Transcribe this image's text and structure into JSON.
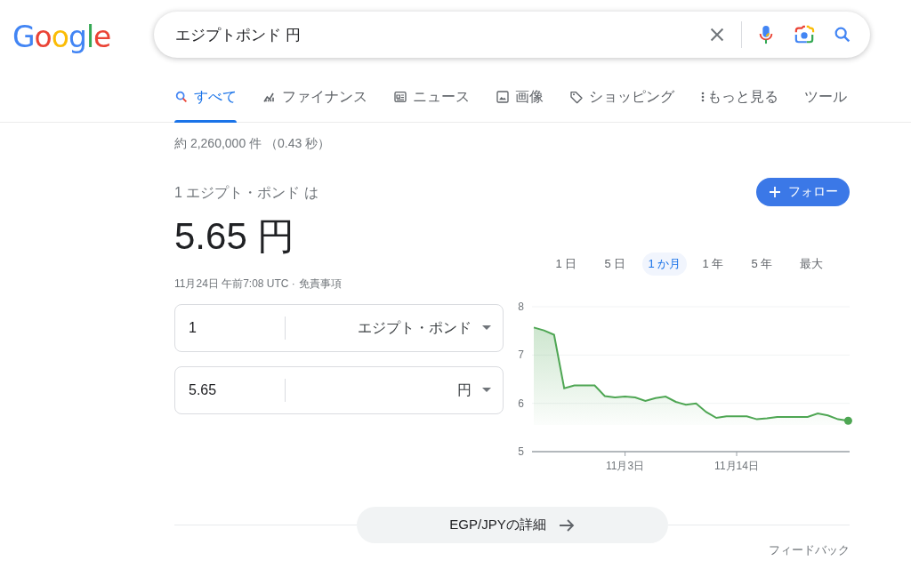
{
  "logo": "Google",
  "search": {
    "value": "エジプトポンド 円"
  },
  "tabs": [
    {
      "label": "すべて",
      "selected": true,
      "kind": "search"
    },
    {
      "label": "ファイナンス",
      "selected": false,
      "kind": "finance"
    },
    {
      "label": "ニュース",
      "selected": false,
      "kind": "news"
    },
    {
      "label": "画像",
      "selected": false,
      "kind": "images"
    },
    {
      "label": "ショッピング",
      "selected": false,
      "kind": "shopping"
    },
    {
      "label": "もっと見る",
      "selected": false,
      "kind": "more"
    },
    {
      "label": "ツール",
      "selected": false,
      "kind": "tools"
    }
  ],
  "result_stats": "約 2,260,000 件 （0.43 秒）",
  "converter": {
    "heading": "1 エジプト・ポンド は",
    "result": "5.65 円",
    "timestamp": "11月24日 午前7:08 UTC ·",
    "disclaimer_link": "免責事項",
    "follow_button": "フォロー",
    "rows": [
      {
        "amount": "1",
        "currency": "エジプト・ポンド"
      },
      {
        "amount": "5.65",
        "currency": "円"
      }
    ],
    "ranges": [
      {
        "label": "1 日",
        "selected": false
      },
      {
        "label": "5 日",
        "selected": false
      },
      {
        "label": "1 か月",
        "selected": true
      },
      {
        "label": "1 年",
        "selected": false
      },
      {
        "label": "5 年",
        "selected": false
      },
      {
        "label": "最大",
        "selected": false
      }
    ],
    "chart_data": {
      "type": "area",
      "categories": [
        null,
        null,
        null,
        null,
        null,
        null,
        null,
        null,
        null,
        "11月3日",
        null,
        null,
        null,
        null,
        null,
        null,
        null,
        null,
        null,
        null,
        "11月14日",
        null,
        null,
        null,
        null,
        null,
        null,
        null,
        null,
        null,
        null,
        null
      ],
      "series": [
        {
          "color": "#4ea653",
          "values": [
            7.57,
            7.51,
            7.42,
            6.31,
            6.37,
            null,
            6.37,
            6.15,
            6.12,
            6.14,
            6.12,
            6.05,
            6.11,
            6.14,
            6.03,
            5.97,
            6.0,
            5.82,
            5.7,
            5.73,
            null,
            5.73,
            5.67,
            5.69,
            5.72,
            null,
            null,
            5.72,
            5.79,
            5.75,
            5.67,
            5.64
          ]
        }
      ],
      "ylim": [
        5,
        8
      ],
      "yticks": [
        5,
        6,
        7,
        8
      ]
    }
  },
  "details_button": "EGP/JPYの詳細",
  "feedback": "フィードバック"
}
